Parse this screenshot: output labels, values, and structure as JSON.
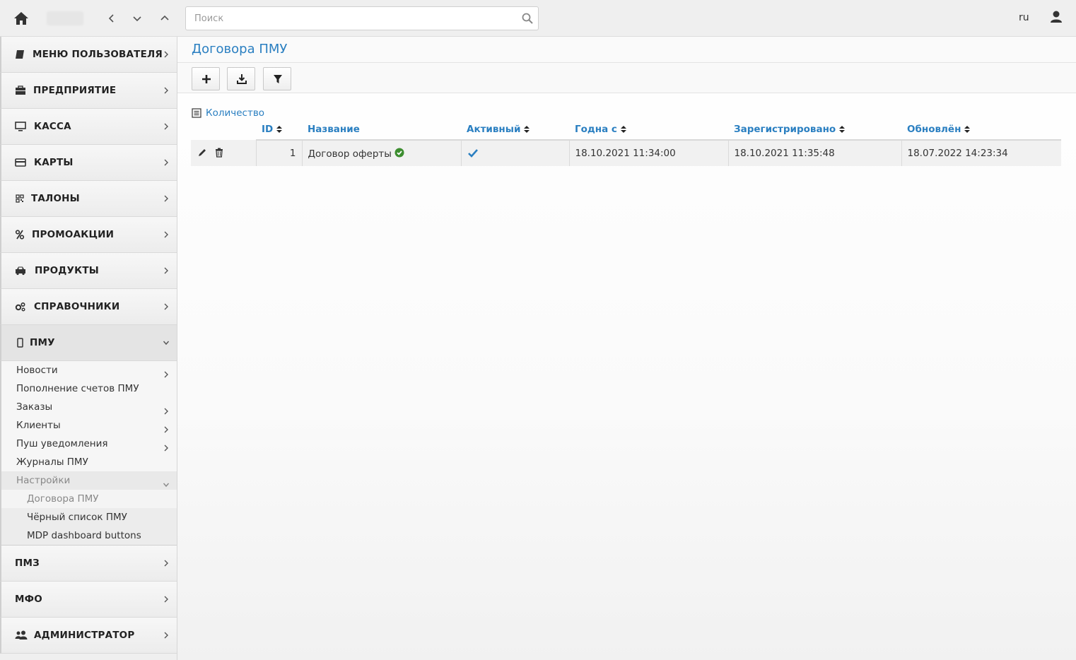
{
  "topbar": {
    "search_placeholder": "Поиск",
    "lang": "ru"
  },
  "sidebar": {
    "sections": [
      {
        "label": "МЕНЮ ПОЛЬЗОВАТЕЛЯ",
        "icon": "book-icon"
      },
      {
        "label": "ПРЕДПРИЯТИЕ",
        "icon": "briefcase-icon"
      },
      {
        "label": "КАССА",
        "icon": "desktop-icon"
      },
      {
        "label": "КАРТЫ",
        "icon": "credit-card-icon"
      },
      {
        "label": "ТАЛОНЫ",
        "icon": "qrcode-icon"
      },
      {
        "label": "ПРОМОАКЦИИ",
        "icon": "percent-icon"
      },
      {
        "label": "ПРОДУКТЫ",
        "icon": "car-icon"
      },
      {
        "label": "СПРАВОЧНИКИ",
        "icon": "cogs-icon"
      },
      {
        "label": "ПМУ",
        "icon": "mobile-icon"
      }
    ],
    "pmu_items": [
      {
        "label": "Новости"
      },
      {
        "label": "Пополнение счетов ПМУ"
      },
      {
        "label": "Заказы"
      },
      {
        "label": "Клиенты"
      },
      {
        "label": "Пуш уведомления"
      },
      {
        "label": "Журналы ПМУ"
      },
      {
        "label": "Настройки"
      }
    ],
    "settings_items": [
      {
        "label": "Договора ПМУ"
      },
      {
        "label": "Чёрный список ПМУ"
      },
      {
        "label": "MDP dashboard buttons"
      }
    ],
    "bottom_sections": [
      {
        "label": "ПМЗ"
      },
      {
        "label": "МФО"
      },
      {
        "label": "АДМИНИСТРАТОР",
        "icon": "users-icon"
      }
    ]
  },
  "main": {
    "title": "Договора ПМУ",
    "count_label": "Количество",
    "columns": {
      "id": "ID",
      "name": "Название",
      "active": "Активный",
      "valid_from": "Годна с",
      "registered": "Зарегистрировано",
      "updated": "Обновлён"
    },
    "rows": [
      {
        "id": "1",
        "name": "Договор оферты",
        "active": true,
        "valid_from": "18.10.2021 11:34:00",
        "registered": "18.10.2021 11:35:48",
        "updated": "18.07.2022 14:23:34"
      }
    ]
  },
  "colors": {
    "accent": "#2a7fc1",
    "success": "#3c8d2f"
  }
}
